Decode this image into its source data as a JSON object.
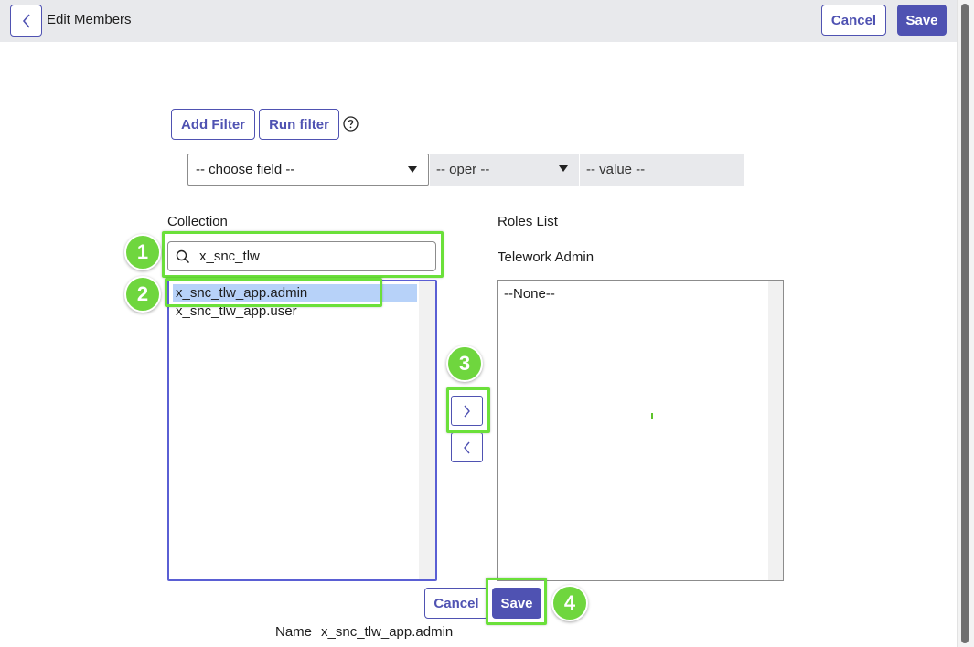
{
  "header": {
    "title": "Edit Members",
    "cancel_label": "Cancel",
    "save_label": "Save"
  },
  "filter": {
    "add_filter_label": "Add Filter",
    "run_filter_label": "Run filter",
    "field_placeholder": "-- choose field --",
    "oper_placeholder": "-- oper --",
    "value_placeholder": "-- value --"
  },
  "collection": {
    "label": "Collection",
    "search_value": "x_snc_tlw",
    "options": [
      "x_snc_tlw_app.admin",
      "x_snc_tlw_app.user"
    ],
    "selected_index": 0
  },
  "roles": {
    "label": "Roles List",
    "group_name": "Telework Admin",
    "options": [
      "--None--"
    ]
  },
  "footer": {
    "cancel_label": "Cancel",
    "save_label": "Save",
    "name_label": "Name",
    "name_value": "x_snc_tlw_app.admin"
  },
  "annotations": {
    "badges": [
      "1",
      "2",
      "3",
      "4"
    ],
    "highlight_color": "#6be03a"
  },
  "colors": {
    "accent": "#4f52b2",
    "selection": "#b7d2f9",
    "header_bg": "#e8e9ec"
  }
}
